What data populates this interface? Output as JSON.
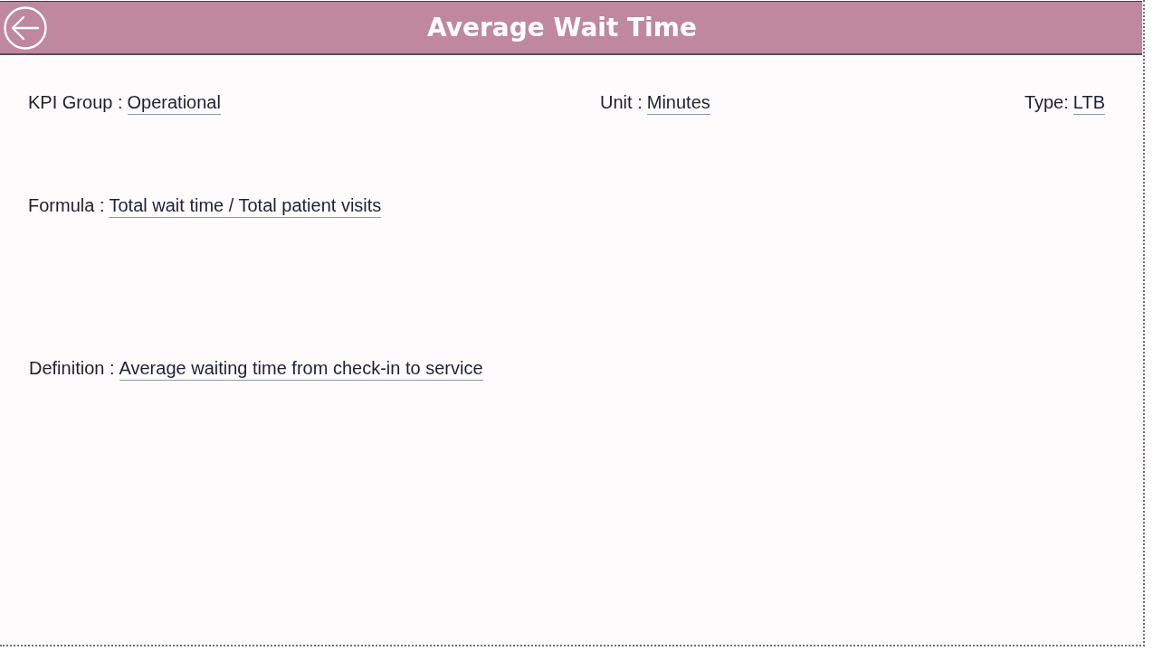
{
  "header": {
    "title": "Average Wait Time"
  },
  "top_fields": [
    {
      "label": "KPI Group :",
      "value": "Operational"
    },
    {
      "label": "Unit :",
      "value": "Minutes"
    },
    {
      "label": "Type:",
      "value": "LTB"
    }
  ],
  "formula": {
    "label": "Formula :",
    "value": "Total wait time / Total patient visits"
  },
  "definition": {
    "label": "Definition :",
    "value": "Average waiting time from check-in to service"
  }
}
